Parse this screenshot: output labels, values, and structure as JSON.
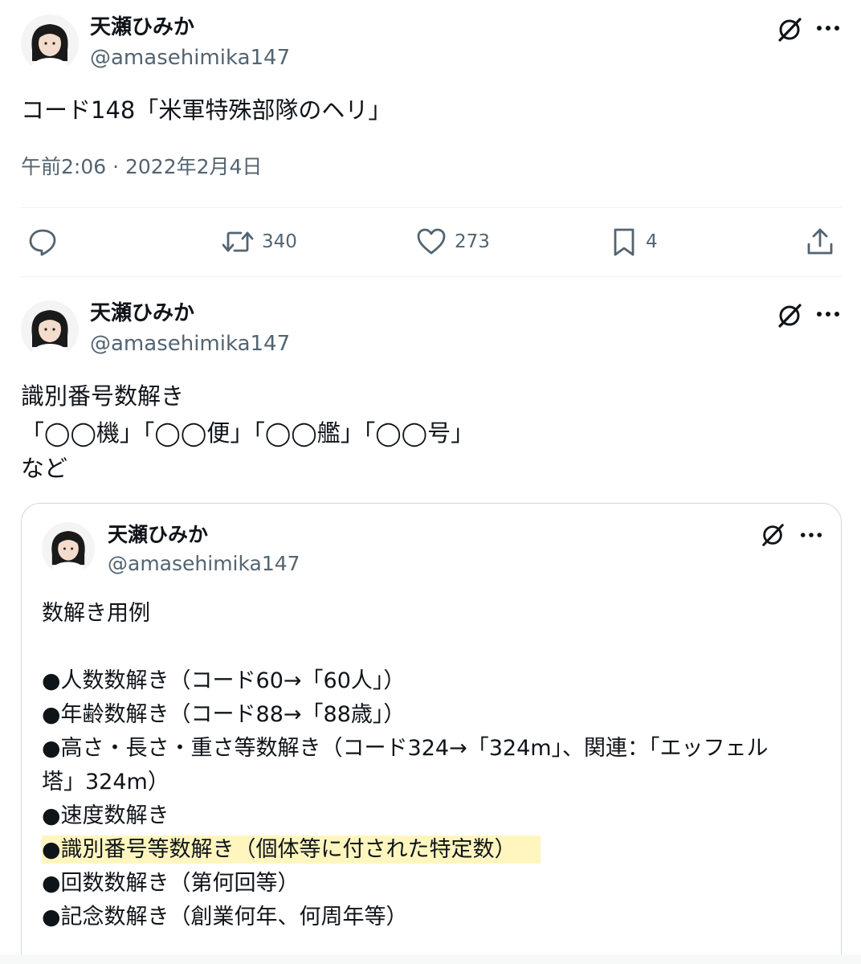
{
  "tweet1": {
    "name": "天瀬ひみか",
    "handle": "@amasehimika147",
    "text": "コード148「米軍特殊部隊のヘリ」",
    "timestamp": "午前2:06 · 2022年2月4日",
    "actions": {
      "retweets": "340",
      "likes": "273",
      "bookmarks": "4"
    }
  },
  "tweet2": {
    "name": "天瀬ひみか",
    "handle": "@amasehimika147",
    "lines": [
      "識別番号数解き",
      "「◯◯機」「◯◯便」「◯◯艦」「◯◯号」",
      "など"
    ]
  },
  "quote": {
    "name": "天瀬ひみか",
    "handle": "@amasehimika147",
    "title": "数解き用例",
    "items": [
      "●人数数解き（コード60→「60人」）",
      "●年齢数解き（コード88→「88歳」）",
      "●高さ・長さ・重さ等数解き（コード324→「324m」、関連：「エッフェル",
      "塔」324m）",
      "●速度数解き",
      "●識別番号等数解き（個体等に付された特定数）",
      "●回数数解き（第何回等）",
      "●記念数解き（創業何年、何周年等）"
    ]
  },
  "icons": {
    "grok": "grok-icon",
    "more": "more-icon",
    "reply": "reply-icon",
    "retweet": "retweet-icon",
    "like": "heart-icon",
    "bookmark": "bookmark-icon",
    "share": "share-icon"
  },
  "colors": {
    "text": "#0f1419",
    "secondary": "#536471",
    "border": "#cfd9de",
    "highlight": "#fff6bf"
  }
}
